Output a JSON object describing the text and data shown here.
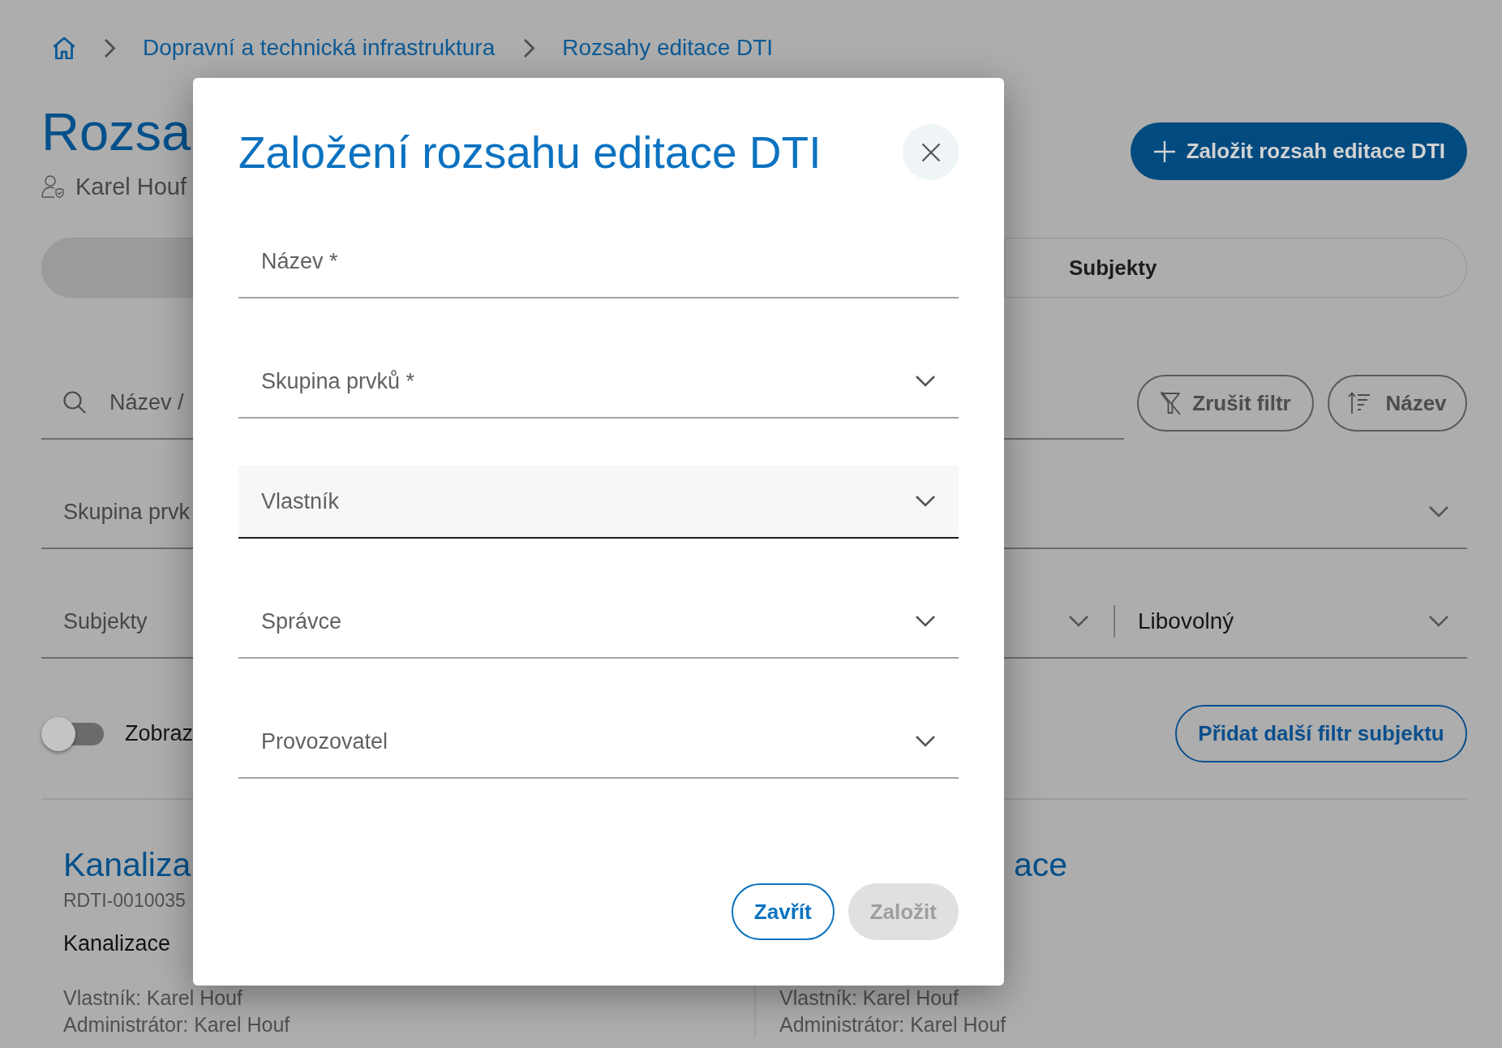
{
  "breadcrumb": [
    {
      "label": "Dopravní a technická infrastruktura"
    },
    {
      "label": "Rozsahy editace DTI"
    }
  ],
  "header": {
    "title": "Rozsa",
    "owner": "Karel Houf",
    "create_button": "Založit rozsah editace DTI"
  },
  "tabs": [
    {
      "selected": true
    },
    {
      "label": "Subjekty",
      "selected": false
    }
  ],
  "filters": {
    "search": {
      "placeholder": "Název /"
    },
    "clear_button": "Zrušit filtr",
    "sort_button": "Název",
    "element_group": {
      "label": "Skupina prvk"
    },
    "subjects": {
      "label": "Subjekty",
      "mode": "Libovolný"
    },
    "toggle": {
      "label": "Zobraz",
      "on": false
    },
    "add_filter_button": "Přidat další filtr subjektu"
  },
  "cards": [
    {
      "title": "Kanaliza",
      "code": "RDTI-0010035",
      "subtitle": "Kanalizace",
      "owner": "Vlastník: Karel Houf",
      "administrator": "Administrátor: Karel Houf"
    },
    {
      "title": "ace",
      "owner": "Vlastník: Karel Houf",
      "administrator": "Administrátor: Karel Houf"
    }
  ],
  "dialog": {
    "title": "Založení rozsahu editace DTI",
    "fields": [
      {
        "kind": "text",
        "label": "Název *",
        "hovered": false
      },
      {
        "kind": "select",
        "label": "Skupina prvků *",
        "hovered": false
      },
      {
        "kind": "select",
        "label": "Vlastník",
        "hovered": true
      },
      {
        "kind": "select",
        "label": "Správce",
        "hovered": false
      },
      {
        "kind": "select",
        "label": "Provozovatel",
        "hovered": false
      }
    ],
    "buttons": [
      {
        "kind": "outlined",
        "label": "Zavřít",
        "disabled": false
      },
      {
        "kind": "filled",
        "label": "Založit",
        "disabled": true
      }
    ]
  }
}
